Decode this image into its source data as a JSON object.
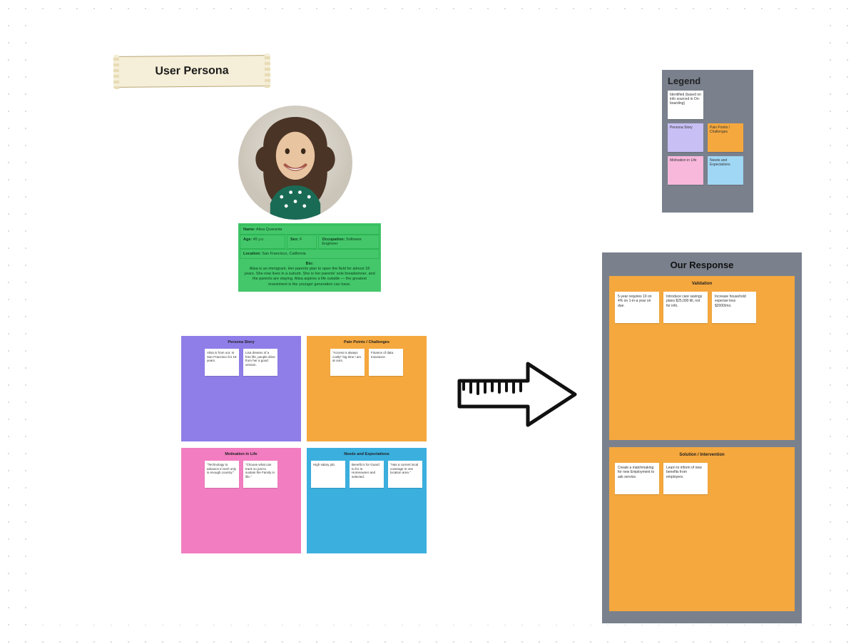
{
  "banner": {
    "title": "User Persona"
  },
  "info": {
    "name_label": "Name:",
    "name": "Alisa Quaranta",
    "age_label": "Age:",
    "age": "45 y.o.",
    "sex_label": "Sex:",
    "sex": "F",
    "job_label": "Occupation:",
    "job": "Software Engineer",
    "location_label": "Location:",
    "location": "San Francisco, California",
    "bio_header": "Bio:",
    "bio": "Alisa is an immigrant. Her parents plan to open the field for almost 18 years. She now lives in a suburb. She is her parents' sole breadwinner, and the parents are staying. Alisa aspires a life outside — the greatest investment is the younger generation can have."
  },
  "sections": {
    "persona": {
      "title": "Persona Story",
      "cards": [
        "Alisa is from out. In San Francisco for 18 years.",
        "Lisa dreams of a free life, people drive from her a good version."
      ]
    },
    "pain": {
      "title": "Pain Points / Challenges",
      "cards": [
        "\"Access is always costly\" big time I am at ours.",
        "Finance of data. Insurance."
      ]
    },
    "motivation": {
      "title": "Motivation in Life",
      "cards": [
        "\"Technology to advance in tech only is enough country.\"",
        "\"Choose what can track so just to sustain the Family in life.\""
      ]
    },
    "needs": {
      "title": "Needs and Expectations",
      "cards": [
        "High salary job.",
        "Benefit is for Guard to for In. Homeowner and selected.",
        "\"Has a current local coverage in one location area.\""
      ]
    }
  },
  "response": {
    "title": "Our Response",
    "validation": {
      "title": "Validation",
      "cards": [
        "5-year requires 10 on 4% on 1-in-a year on due.",
        "Introduce care savings plans $25,000 till, not for info.",
        "Increase household expense less $2000/mo."
      ]
    },
    "solution": {
      "title": "Solution / Intervention",
      "cards": [
        "Create a matchmaking for new Employment to ask service.",
        "Learn to inform of new benefits from employers."
      ]
    }
  },
  "legend": {
    "title": "Legend",
    "items": {
      "identified": "Identified (based on info sourced in On-boarding)",
      "persona": "Persona Story",
      "pain": "Pain Points / Challenges",
      "motivation": "Motivation in Life",
      "needs": "Needs and Expectations"
    }
  }
}
